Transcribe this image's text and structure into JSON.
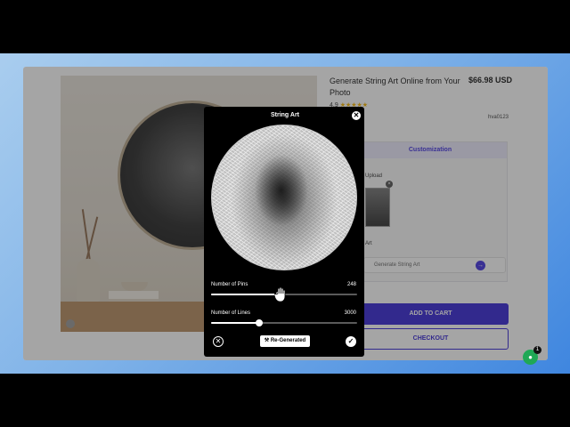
{
  "product": {
    "title": "Generate String Art Online from Your Photo",
    "price": "$66.98 USD",
    "rating_value": "4.9",
    "stars": "★★★★★",
    "sku": "hva0123"
  },
  "customization": {
    "tab_label": "Customization",
    "upload_label": "Upload",
    "thumb_remove": "×",
    "art_label": "Art",
    "generate_text": "Generate String Art",
    "generate_arrow": "→"
  },
  "actions": {
    "add_to_cart": "ADD TO CART",
    "checkout": "CHECKOUT"
  },
  "modal": {
    "title": "String Art",
    "close_glyph": "✕",
    "pins": {
      "label": "Number of Pins",
      "value": "248",
      "fraction": 0.47
    },
    "lines": {
      "label": "Number of Lines",
      "value": "3000",
      "fraction": 0.33
    },
    "cancel_glyph": "✕",
    "regenerate_label": "Re-Generated",
    "confirm_glyph": "✓"
  },
  "chat": {
    "glyph": "●",
    "badge": "1"
  },
  "icons": {
    "close": "close-icon",
    "hand": "hand-cursor-icon",
    "check": "check-icon",
    "chat": "chat-icon",
    "magic": "magic-wand-icon"
  }
}
